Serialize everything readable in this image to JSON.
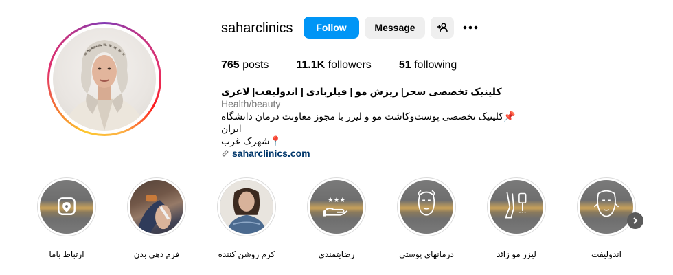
{
  "profile": {
    "username": "saharclinics",
    "follow_label": "Follow",
    "message_label": "Message",
    "add_user_icon": "person-add-icon",
    "more_icon": "more-options-icon",
    "stats": {
      "posts_count": "765",
      "posts_label": "posts",
      "followers_count": "11.1K",
      "followers_label": "followers",
      "following_count": "51",
      "following_label": "following"
    },
    "bio": {
      "name": "کلینیک تخصصی سحر| ریزش مو | فیلربادی | اندولیفت| لاغری",
      "category": "Health/beauty",
      "line1": "📌کلینیک تخصصی پوست‌وکاشت مو و لیزر با مجوز معاونت درمان دانشگاه ایران",
      "line2": "📍شهرک غرب",
      "link": "saharclinics.com",
      "link_icon": "link-icon"
    }
  },
  "highlights": [
    {
      "label": "ارتباط باما",
      "icon": "location-pin-icon"
    },
    {
      "label": "فرم دهی بدن",
      "icon": "photo"
    },
    {
      "label": "کرم روشن کننده",
      "icon": "photo"
    },
    {
      "label": "رضایتمندی",
      "icon": "hand-stars-icon"
    },
    {
      "label": "درمانهای پوستی",
      "icon": "face-icon"
    },
    {
      "label": "لیزر مو زائد",
      "icon": "laser-leg-icon"
    },
    {
      "label": "اندولیفت",
      "icon": "face-lift-icon"
    }
  ],
  "colors": {
    "follow_button": "#0095f6",
    "secondary_button": "#efefef",
    "link": "#00376b",
    "category": "#737373"
  }
}
